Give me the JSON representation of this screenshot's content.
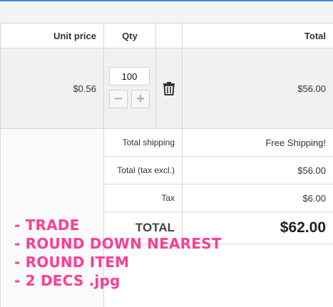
{
  "table": {
    "headers": {
      "unit_price": "Unit price",
      "qty": "Qty",
      "total": "Total"
    },
    "item": {
      "unit_price": "$0.56",
      "qty_value": "100",
      "minus_symbol": "−",
      "plus_symbol": "+",
      "total": "$56.00"
    }
  },
  "summary": {
    "shipping_label": "Total shipping",
    "shipping_value": "Free Shipping!",
    "tax_excl_label": "Total (tax excl.)",
    "tax_excl_value": "$56.00",
    "tax_label": "Tax",
    "tax_value": "$6.00",
    "total_label": "TOTAL",
    "total_value": "$62.00"
  },
  "annotation": {
    "lines": [
      "- TRADE",
      "- ROUND DOWN NEAREST",
      "- ROUND ITEM",
      "- 2 DECS .jpg"
    ],
    "color": "#ff3d94"
  },
  "icons": {
    "delete": "trash-icon"
  }
}
